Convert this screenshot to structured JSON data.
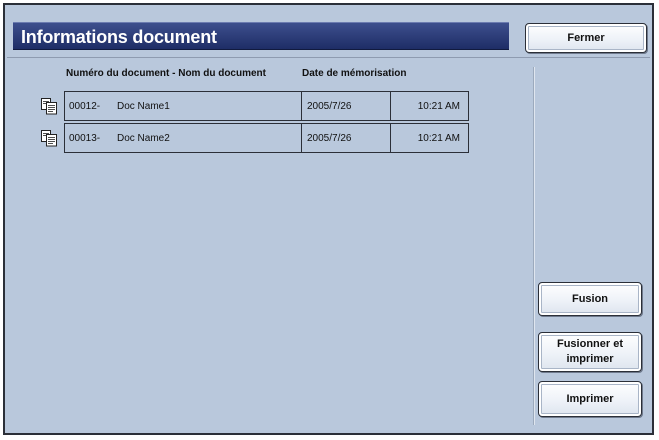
{
  "window": {
    "title": "Informations document",
    "close_label": "Fermer"
  },
  "table": {
    "headers": {
      "name": "Numéro du document - Nom du document",
      "date": "Date de mémorisation"
    },
    "rows": [
      {
        "number": "00012-",
        "name": "Doc Name1",
        "date": "2005/7/26",
        "time": "10:21 AM",
        "icon": "document-copy-icon"
      },
      {
        "number": "00013-",
        "name": "Doc Name2",
        "date": "2005/7/26",
        "time": "10:21 AM",
        "icon": "document-copy-icon"
      }
    ]
  },
  "actions": {
    "fusion_label": "Fusion",
    "fusion_print_label_line1": "Fusionner et",
    "fusion_print_label_line2": "imprimer",
    "print_label": "Imprimer"
  },
  "colors": {
    "panel_background": "#b9c8dc",
    "title_bar": "#2a3a78",
    "button_face": "#f4f6fa"
  }
}
